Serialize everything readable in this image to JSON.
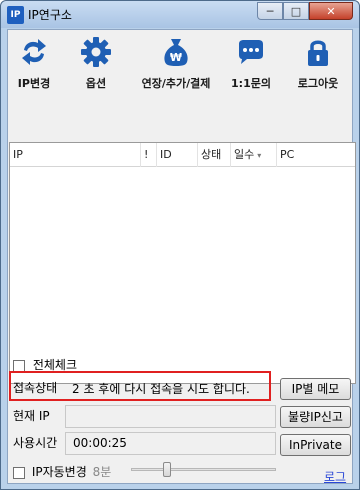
{
  "window": {
    "title": "IP연구소",
    "app_icon_text": "IP",
    "controls": {
      "minimize": "─",
      "maximize": "□",
      "close": "✕"
    }
  },
  "toolbar": [
    {
      "label": "IP변경",
      "icon": "refresh-arrows-icon"
    },
    {
      "label": "옵션",
      "icon": "gear-icon"
    },
    {
      "label": "연장/추가/결제",
      "icon": "money-bag-icon"
    },
    {
      "label": "1:1문의",
      "icon": "chat-bubble-icon"
    },
    {
      "label": "로그아웃",
      "icon": "lock-icon"
    }
  ],
  "grid": {
    "columns": [
      "IP",
      "!",
      "ID",
      "상태",
      "일수",
      "PC"
    ],
    "rows": []
  },
  "select_all_label": "전체체크",
  "status": {
    "label": "접속상태",
    "message": "2 초 후에 다시 접속을 시도 합니다."
  },
  "current_ip": {
    "label": "현재 IP",
    "value": ""
  },
  "usage_time": {
    "label": "사용시간",
    "value": "00:00:25"
  },
  "buttons": {
    "ip_memo": "IP별 메모",
    "report_bad_ip": "불량IP신고",
    "inprivate": "InPrivate"
  },
  "auto_change": {
    "label": "IP자동변경",
    "interval": "8분",
    "checked": false
  },
  "log_link": "로그",
  "colors": {
    "accent_blue": "#1e5fbf",
    "status_border": "#e02020",
    "link": "#2a47d6"
  }
}
